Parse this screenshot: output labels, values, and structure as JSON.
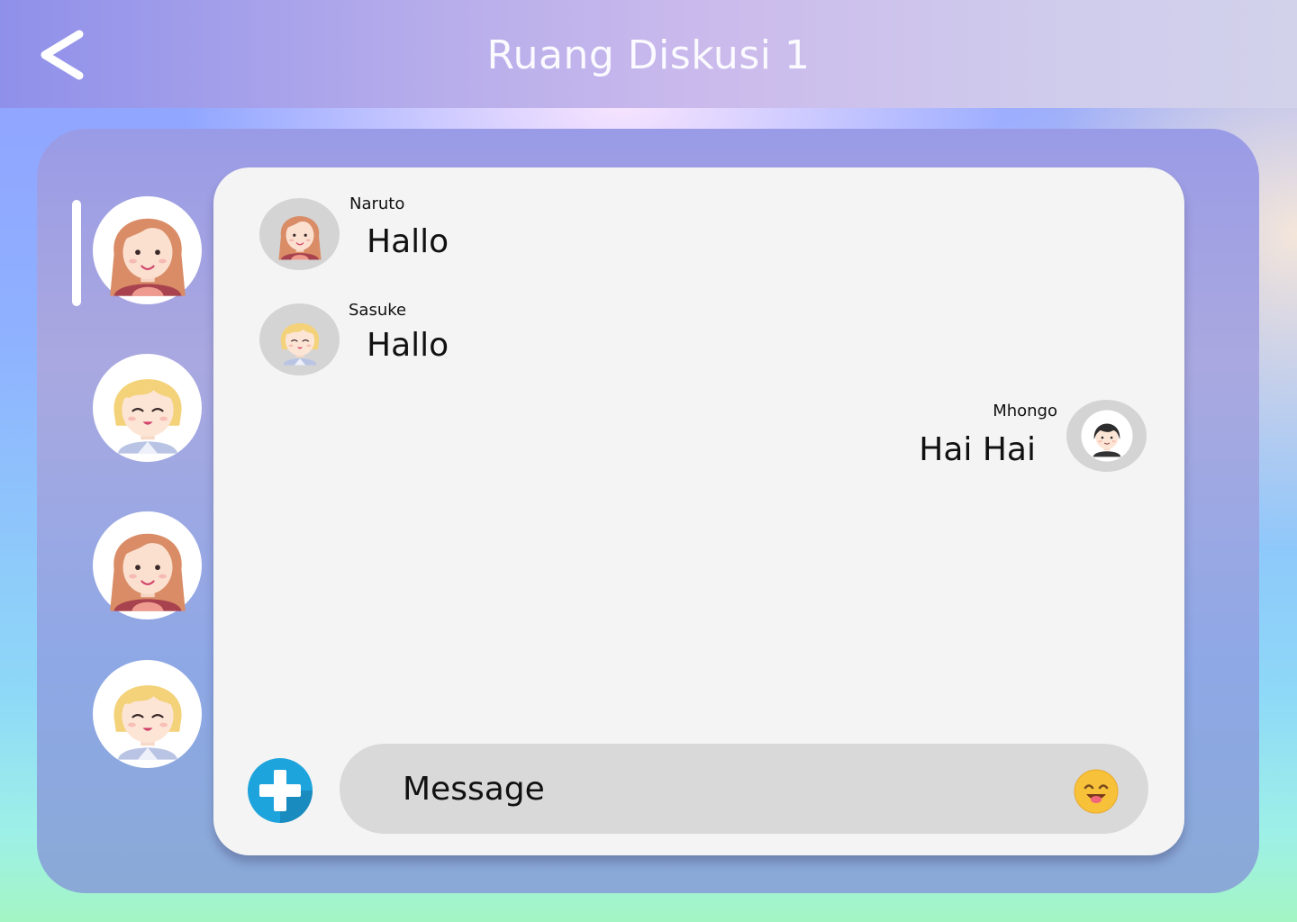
{
  "header": {
    "title": "Ruang Diskusi 1",
    "back_icon": "chevron-left-icon"
  },
  "sidebar": {
    "items": [
      {
        "avatar": "girl-avatar",
        "active": true
      },
      {
        "avatar": "blond-boy-avatar",
        "active": false
      },
      {
        "avatar": "girl-avatar",
        "active": false
      },
      {
        "avatar": "blond-boy-avatar",
        "active": false
      }
    ]
  },
  "chat": {
    "messages": [
      {
        "sender": "Naruto",
        "text": "Hallo",
        "avatar": "girl-avatar",
        "side": "left"
      },
      {
        "sender": "Sasuke",
        "text": "Hallo",
        "avatar": "blond-boy-avatar",
        "side": "left"
      },
      {
        "sender": "Mhongo",
        "text": "Hai Hai",
        "avatar": "dark-hair-boy-avatar",
        "side": "right"
      }
    ]
  },
  "composer": {
    "placeholder": "Message",
    "add_icon": "plus-icon",
    "emoji_icon": "smiley-emoji-icon"
  },
  "colors": {
    "header_gradient_start": "#8f90ea",
    "header_gradient_end": "#d2d2eb",
    "panel": "#9aa4e2",
    "chat_bg": "#f4f4f4",
    "input_bg": "#d9d9d9",
    "add_button": "#1ea4dc",
    "emoji": "#f7c23a"
  }
}
